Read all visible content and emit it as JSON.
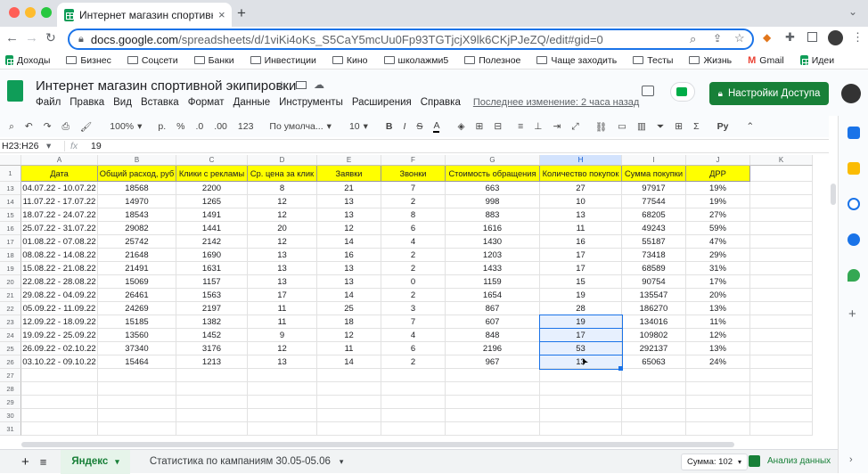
{
  "browser": {
    "tab_title": "Интернет магазин спортивно",
    "url_host": "docs.google.com",
    "url_path": "/spreadsheets/d/1viKi4oKs_S5CaY5mcUu0Fp93TGTjcjX9lk6CKjPJeZQ/edit#gid=0",
    "bookmarks": [
      "Доходы",
      "Бизнес",
      "Соцсети",
      "Банки",
      "Инвестиции",
      "Кино",
      "школажми5",
      "Полезное",
      "Чаще заходить",
      "Тесты",
      "Жизнь",
      "Gmail",
      "Идеи"
    ]
  },
  "doc": {
    "title": "Интернет магазин спортивной экипировки",
    "menu": [
      "Файл",
      "Правка",
      "Вид",
      "Вставка",
      "Формат",
      "Данные",
      "Инструменты",
      "Расширения",
      "Справка"
    ],
    "last_edit": "Последнее изменение: 2 часа назад",
    "share_label": "Настройки Доступа"
  },
  "toolbar": {
    "zoom": "100%",
    "currency": "р.",
    "percent": "%",
    "dec_less": ".0",
    "dec_more": ".00",
    "format_num": "123",
    "font": "По умолча...",
    "font_size": "10",
    "bold": "B",
    "italic": "I",
    "strike": "S",
    "text_color": "A",
    "input_tools": "Ру"
  },
  "formula_bar": {
    "name_box": "H23:H26",
    "value": "19"
  },
  "columns": [
    "A",
    "B",
    "C",
    "D",
    "E",
    "F",
    "G",
    "H",
    "I",
    "J",
    "K"
  ],
  "headers": [
    "Дата",
    "Общий расход, руб",
    "Клики с рекламы",
    "Ср. цена за клик",
    "Заявки",
    "Звонки",
    "Стоимость обращения",
    "Количество покупок",
    "Сумма покупки",
    "ДРР"
  ],
  "rows": [
    {
      "n": "13",
      "cells": [
        "04.07.22 - 10.07.22",
        "18568",
        "2200",
        "8",
        "21",
        "7",
        "663",
        "27",
        "97917",
        "19%"
      ]
    },
    {
      "n": "14",
      "cells": [
        "11.07.22 - 17.07.22",
        "14970",
        "1265",
        "12",
        "13",
        "2",
        "998",
        "10",
        "77544",
        "19%"
      ]
    },
    {
      "n": "15",
      "cells": [
        "18.07.22 - 24.07.22",
        "18543",
        "1491",
        "12",
        "13",
        "8",
        "883",
        "13",
        "68205",
        "27%"
      ]
    },
    {
      "n": "16",
      "cells": [
        "25.07.22 - 31.07.22",
        "29082",
        "1441",
        "20",
        "12",
        "6",
        "1616",
        "11",
        "49243",
        "59%"
      ]
    },
    {
      "n": "17",
      "cells": [
        "01.08.22 - 07.08.22",
        "25742",
        "2142",
        "12",
        "14",
        "4",
        "1430",
        "16",
        "55187",
        "47%"
      ]
    },
    {
      "n": "18",
      "cells": [
        "08.08.22 - 14.08.22",
        "21648",
        "1690",
        "13",
        "16",
        "2",
        "1203",
        "17",
        "73418",
        "29%"
      ]
    },
    {
      "n": "19",
      "cells": [
        "15.08.22 - 21.08.22",
        "21491",
        "1631",
        "13",
        "13",
        "2",
        "1433",
        "17",
        "68589",
        "31%"
      ]
    },
    {
      "n": "20",
      "cells": [
        "22.08.22 - 28.08.22",
        "15069",
        "1157",
        "13",
        "13",
        "0",
        "1159",
        "15",
        "90754",
        "17%"
      ]
    },
    {
      "n": "21",
      "cells": [
        "29.08.22 - 04.09.22",
        "26461",
        "1563",
        "17",
        "14",
        "2",
        "1654",
        "19",
        "135547",
        "20%"
      ]
    },
    {
      "n": "22",
      "cells": [
        "05.09.22 - 11.09.22",
        "24269",
        "2197",
        "11",
        "25",
        "3",
        "867",
        "28",
        "186270",
        "13%"
      ]
    },
    {
      "n": "23",
      "cells": [
        "12.09.22 - 18.09.22",
        "15185",
        "1382",
        "11",
        "18",
        "7",
        "607",
        "19",
        "134016",
        "11%"
      ]
    },
    {
      "n": "24",
      "cells": [
        "19.09.22 - 25.09.22",
        "13560",
        "1452",
        "9",
        "12",
        "4",
        "848",
        "17",
        "109802",
        "12%"
      ]
    },
    {
      "n": "25",
      "cells": [
        "26.09.22 - 02.10.22",
        "37340",
        "3176",
        "12",
        "11",
        "6",
        "2196",
        "53",
        "292137",
        "13%"
      ]
    },
    {
      "n": "26",
      "cells": [
        "03.10.22 - 09.10.22",
        "15464",
        "1213",
        "13",
        "14",
        "2",
        "967",
        "13",
        "65063",
        "24%"
      ]
    }
  ],
  "empty_rows": [
    "27",
    "28",
    "29",
    "30",
    "31"
  ],
  "header_row_num": "1",
  "bottom": {
    "sheet_active": "Яндекс",
    "sheet_other": "Статистика по кампаниям 30.05-05.06",
    "sum_label": "Сумма: 102",
    "explore_label": "Анализ данных"
  },
  "colors": {
    "accent": "#1a73e8",
    "header_yellow": "#ffff00",
    "share_green": "#188038"
  }
}
